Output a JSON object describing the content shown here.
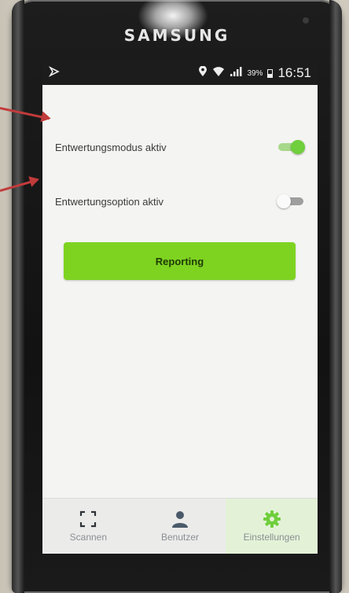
{
  "device": {
    "brand": "SAMSUNG"
  },
  "status_bar": {
    "time": "16:51",
    "battery_percent": "39%",
    "icons": [
      "notification-icon",
      "location-pin-icon",
      "wifi-icon",
      "cellular-signal-icon",
      "battery-icon"
    ]
  },
  "settings": {
    "items": [
      {
        "label": "Entwertungsmodus aktiv",
        "enabled": true
      },
      {
        "label": "Entwertungsoption aktiv",
        "enabled": false
      }
    ]
  },
  "reporting_button": {
    "label": "Reporting"
  },
  "bottom_nav": {
    "items": [
      {
        "label": "Scannen",
        "icon": "scan-frame-icon",
        "active": false
      },
      {
        "label": "Benutzer",
        "icon": "user-icon",
        "active": false
      },
      {
        "label": "Einstellungen",
        "icon": "gear-icon",
        "active": true
      }
    ]
  },
  "colors": {
    "accent": "#7ed321",
    "toggle_on": "#6fcf3c",
    "nav_active_bg": "#e3f2d7",
    "annotation_arrow": "#c23b3b"
  }
}
